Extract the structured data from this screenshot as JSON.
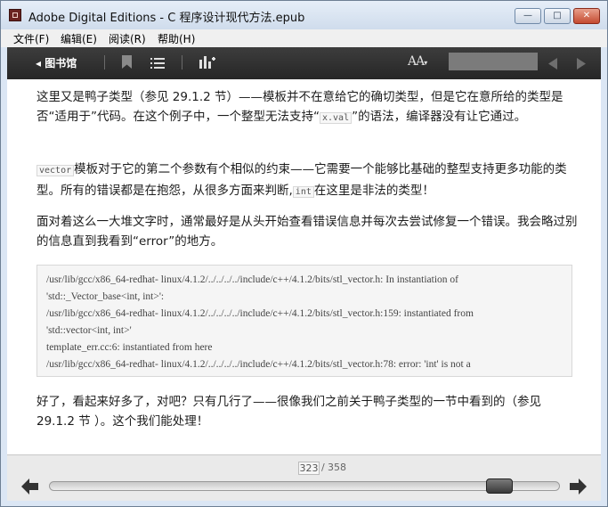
{
  "window": {
    "title": "Adobe Digital Editions - C  程序设计现代方法.epub",
    "minimize_label": "—",
    "maximize_label": "□",
    "close_label": "✕"
  },
  "menu": {
    "file": "文件(F)",
    "edit": "编辑(E)",
    "read": "阅读(R)",
    "help": "帮助(H)"
  },
  "toolbar": {
    "library_label": "◂ 图书馆",
    "font_size_label": "AA",
    "search_value": "",
    "search_placeholder": ""
  },
  "content": {
    "p1_a": "这里又是鸭子类型（参见 29.1.2 节）——模板并不在意给它的确切类型，但是它在意所给的类型是否“适用于”代码。在这个例子中，一个整型无法支持“",
    "p1_code": "x.val",
    "p1_b": "”的语法，编译器没有让它通过。",
    "p2_code1": "vector",
    "p2_a": "模板对于它的第二个参数有个相似的约束——它需要一个能够比基础的整型支持更多功能的类型。所有的错误都是在抱怨，从很多方面来判断,",
    "p2_code2": "int",
    "p2_b": "在这里是非法的类型！",
    "p3": "面对着这么一大堆文字时，通常最好是从头开始查看错误信息并每次去尝试修复一个错误。我会略过别的信息直到我看到“error”的地方。",
    "code_lines": [
      "/usr/lib/gcc/x86_64-redhat- linux/4.1.2/../../../../include/c++/4.1.2/bits/stl_vector.h: In instantiation of",
      "'std::_Vector_base<int, int>':",
      "/usr/lib/gcc/x86_64-redhat- linux/4.1.2/../../../../include/c++/4.1.2/bits/stl_vector.h:159: instantiated from",
      "'std::vector<int, int>'",
      "template_err.cc:6: instantiated from here",
      "/usr/lib/gcc/x86_64-redhat- linux/4.1.2/../../../../include/c++/4.1.2/bits/stl_vector.h:78: error: 'int' is not a"
    ],
    "p4": "好了，看起来好多了，对吧？只有几行了——很像我们之前关于鸭子类型的一节中看到的（参见 29.1.2 节 ）。这个我们能处理！"
  },
  "pagination": {
    "current_page": "323",
    "separator": "/",
    "total_pages": "358",
    "progress_fraction": 0.902
  }
}
